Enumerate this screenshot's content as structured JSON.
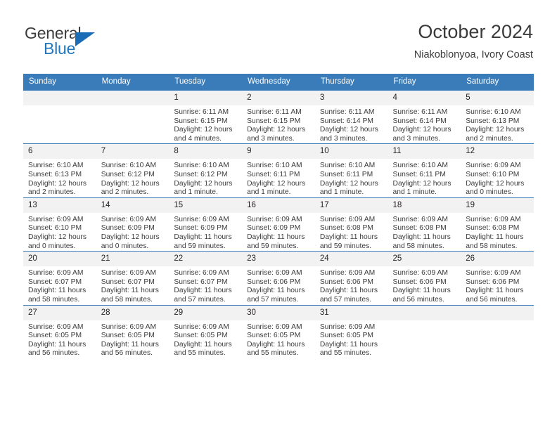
{
  "brand": {
    "word_one": "General",
    "word_two": "Blue",
    "triangle_icon": "triangle-icon",
    "accent_color": "#1a6cb5"
  },
  "header": {
    "title": "October 2024",
    "subtitle": "Niakoblonyoa, Ivory Coast"
  },
  "calendar": {
    "header_color": "#3a7cba",
    "daynum_band_color": "#f2f2f2",
    "weekdays": [
      "Sunday",
      "Monday",
      "Tuesday",
      "Wednesday",
      "Thursday",
      "Friday",
      "Saturday"
    ],
    "weeks": [
      [
        {
          "day": "",
          "sunrise": "",
          "sunset": "",
          "daylight_line1": "",
          "daylight_line2": ""
        },
        {
          "day": "",
          "sunrise": "",
          "sunset": "",
          "daylight_line1": "",
          "daylight_line2": ""
        },
        {
          "day": "1",
          "sunrise": "Sunrise: 6:11 AM",
          "sunset": "Sunset: 6:15 PM",
          "daylight_line1": "Daylight: 12 hours",
          "daylight_line2": "and 4 minutes."
        },
        {
          "day": "2",
          "sunrise": "Sunrise: 6:11 AM",
          "sunset": "Sunset: 6:15 PM",
          "daylight_line1": "Daylight: 12 hours",
          "daylight_line2": "and 3 minutes."
        },
        {
          "day": "3",
          "sunrise": "Sunrise: 6:11 AM",
          "sunset": "Sunset: 6:14 PM",
          "daylight_line1": "Daylight: 12 hours",
          "daylight_line2": "and 3 minutes."
        },
        {
          "day": "4",
          "sunrise": "Sunrise: 6:11 AM",
          "sunset": "Sunset: 6:14 PM",
          "daylight_line1": "Daylight: 12 hours",
          "daylight_line2": "and 3 minutes."
        },
        {
          "day": "5",
          "sunrise": "Sunrise: 6:10 AM",
          "sunset": "Sunset: 6:13 PM",
          "daylight_line1": "Daylight: 12 hours",
          "daylight_line2": "and 2 minutes."
        }
      ],
      [
        {
          "day": "6",
          "sunrise": "Sunrise: 6:10 AM",
          "sunset": "Sunset: 6:13 PM",
          "daylight_line1": "Daylight: 12 hours",
          "daylight_line2": "and 2 minutes."
        },
        {
          "day": "7",
          "sunrise": "Sunrise: 6:10 AM",
          "sunset": "Sunset: 6:12 PM",
          "daylight_line1": "Daylight: 12 hours",
          "daylight_line2": "and 2 minutes."
        },
        {
          "day": "8",
          "sunrise": "Sunrise: 6:10 AM",
          "sunset": "Sunset: 6:12 PM",
          "daylight_line1": "Daylight: 12 hours",
          "daylight_line2": "and 1 minute."
        },
        {
          "day": "9",
          "sunrise": "Sunrise: 6:10 AM",
          "sunset": "Sunset: 6:11 PM",
          "daylight_line1": "Daylight: 12 hours",
          "daylight_line2": "and 1 minute."
        },
        {
          "day": "10",
          "sunrise": "Sunrise: 6:10 AM",
          "sunset": "Sunset: 6:11 PM",
          "daylight_line1": "Daylight: 12 hours",
          "daylight_line2": "and 1 minute."
        },
        {
          "day": "11",
          "sunrise": "Sunrise: 6:10 AM",
          "sunset": "Sunset: 6:11 PM",
          "daylight_line1": "Daylight: 12 hours",
          "daylight_line2": "and 1 minute."
        },
        {
          "day": "12",
          "sunrise": "Sunrise: 6:09 AM",
          "sunset": "Sunset: 6:10 PM",
          "daylight_line1": "Daylight: 12 hours",
          "daylight_line2": "and 0 minutes."
        }
      ],
      [
        {
          "day": "13",
          "sunrise": "Sunrise: 6:09 AM",
          "sunset": "Sunset: 6:10 PM",
          "daylight_line1": "Daylight: 12 hours",
          "daylight_line2": "and 0 minutes."
        },
        {
          "day": "14",
          "sunrise": "Sunrise: 6:09 AM",
          "sunset": "Sunset: 6:09 PM",
          "daylight_line1": "Daylight: 12 hours",
          "daylight_line2": "and 0 minutes."
        },
        {
          "day": "15",
          "sunrise": "Sunrise: 6:09 AM",
          "sunset": "Sunset: 6:09 PM",
          "daylight_line1": "Daylight: 11 hours",
          "daylight_line2": "and 59 minutes."
        },
        {
          "day": "16",
          "sunrise": "Sunrise: 6:09 AM",
          "sunset": "Sunset: 6:09 PM",
          "daylight_line1": "Daylight: 11 hours",
          "daylight_line2": "and 59 minutes."
        },
        {
          "day": "17",
          "sunrise": "Sunrise: 6:09 AM",
          "sunset": "Sunset: 6:08 PM",
          "daylight_line1": "Daylight: 11 hours",
          "daylight_line2": "and 59 minutes."
        },
        {
          "day": "18",
          "sunrise": "Sunrise: 6:09 AM",
          "sunset": "Sunset: 6:08 PM",
          "daylight_line1": "Daylight: 11 hours",
          "daylight_line2": "and 58 minutes."
        },
        {
          "day": "19",
          "sunrise": "Sunrise: 6:09 AM",
          "sunset": "Sunset: 6:08 PM",
          "daylight_line1": "Daylight: 11 hours",
          "daylight_line2": "and 58 minutes."
        }
      ],
      [
        {
          "day": "20",
          "sunrise": "Sunrise: 6:09 AM",
          "sunset": "Sunset: 6:07 PM",
          "daylight_line1": "Daylight: 11 hours",
          "daylight_line2": "and 58 minutes."
        },
        {
          "day": "21",
          "sunrise": "Sunrise: 6:09 AM",
          "sunset": "Sunset: 6:07 PM",
          "daylight_line1": "Daylight: 11 hours",
          "daylight_line2": "and 58 minutes."
        },
        {
          "day": "22",
          "sunrise": "Sunrise: 6:09 AM",
          "sunset": "Sunset: 6:07 PM",
          "daylight_line1": "Daylight: 11 hours",
          "daylight_line2": "and 57 minutes."
        },
        {
          "day": "23",
          "sunrise": "Sunrise: 6:09 AM",
          "sunset": "Sunset: 6:06 PM",
          "daylight_line1": "Daylight: 11 hours",
          "daylight_line2": "and 57 minutes."
        },
        {
          "day": "24",
          "sunrise": "Sunrise: 6:09 AM",
          "sunset": "Sunset: 6:06 PM",
          "daylight_line1": "Daylight: 11 hours",
          "daylight_line2": "and 57 minutes."
        },
        {
          "day": "25",
          "sunrise": "Sunrise: 6:09 AM",
          "sunset": "Sunset: 6:06 PM",
          "daylight_line1": "Daylight: 11 hours",
          "daylight_line2": "and 56 minutes."
        },
        {
          "day": "26",
          "sunrise": "Sunrise: 6:09 AM",
          "sunset": "Sunset: 6:06 PM",
          "daylight_line1": "Daylight: 11 hours",
          "daylight_line2": "and 56 minutes."
        }
      ],
      [
        {
          "day": "27",
          "sunrise": "Sunrise: 6:09 AM",
          "sunset": "Sunset: 6:05 PM",
          "daylight_line1": "Daylight: 11 hours",
          "daylight_line2": "and 56 minutes."
        },
        {
          "day": "28",
          "sunrise": "Sunrise: 6:09 AM",
          "sunset": "Sunset: 6:05 PM",
          "daylight_line1": "Daylight: 11 hours",
          "daylight_line2": "and 56 minutes."
        },
        {
          "day": "29",
          "sunrise": "Sunrise: 6:09 AM",
          "sunset": "Sunset: 6:05 PM",
          "daylight_line1": "Daylight: 11 hours",
          "daylight_line2": "and 55 minutes."
        },
        {
          "day": "30",
          "sunrise": "Sunrise: 6:09 AM",
          "sunset": "Sunset: 6:05 PM",
          "daylight_line1": "Daylight: 11 hours",
          "daylight_line2": "and 55 minutes."
        },
        {
          "day": "31",
          "sunrise": "Sunrise: 6:09 AM",
          "sunset": "Sunset: 6:05 PM",
          "daylight_line1": "Daylight: 11 hours",
          "daylight_line2": "and 55 minutes."
        },
        {
          "day": "",
          "sunrise": "",
          "sunset": "",
          "daylight_line1": "",
          "daylight_line2": ""
        },
        {
          "day": "",
          "sunrise": "",
          "sunset": "",
          "daylight_line1": "",
          "daylight_line2": ""
        }
      ]
    ]
  }
}
